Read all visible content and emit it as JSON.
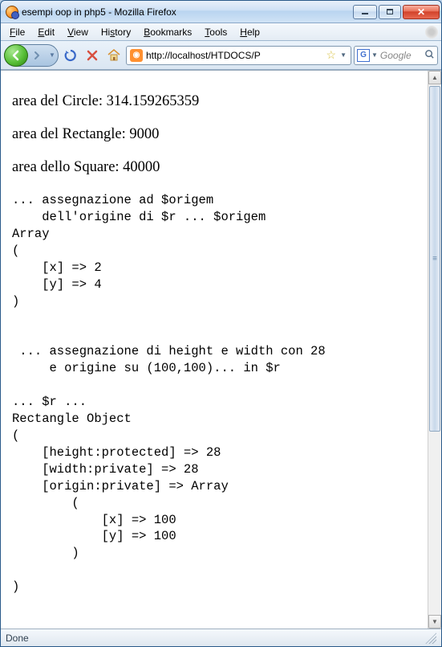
{
  "window": {
    "title": "esempi oop in php5 - Mozilla Firefox"
  },
  "menubar": {
    "file": "File",
    "edit": "Edit",
    "view": "View",
    "history": "History",
    "bookmarks": "Bookmarks",
    "tools": "Tools",
    "help": "Help"
  },
  "toolbar": {
    "url": "http://localhost/HTDOCS/P",
    "search_placeholder": "Google",
    "search_engine_initial": "G"
  },
  "page": {
    "circle_line": "area del Circle: 314.159265359",
    "rectangle_line": "area del Rectangle: 9000",
    "square_line": "area dello Square: 40000",
    "pre1": "... assegnazione ad $origem\n    dell'origine di $r ... $origem\nArray\n(\n    [x] => 2\n    [y] => 4\n)\n\n\n ... assegnazione di height e width con 28\n     e origine su (100,100)... in $r\n\n... $r ... \nRectangle Object\n(\n    [height:protected] => 28\n    [width:private] => 28\n    [origin:private] => Array\n        (\n            [x] => 100\n            [y] => 100\n        )\n\n)"
  },
  "statusbar": {
    "text": "Done"
  }
}
